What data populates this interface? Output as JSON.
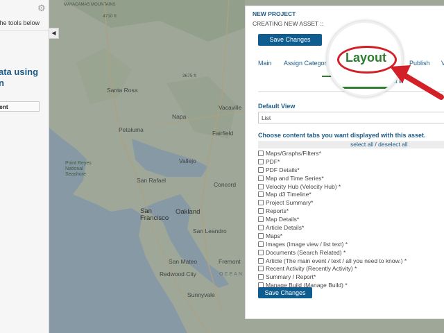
{
  "sidebar": {
    "hint_text": "the tools below",
    "heading_line1": "ata using",
    "heading_line2": "n",
    "button_label": "ent"
  },
  "map": {
    "labels": {
      "mountain": "MAYACAMAS MOUNTAINS",
      "elev1": "4710 ft",
      "elev2": "3675 ft",
      "santa_rosa": "Santa Rosa",
      "napa": "Napa",
      "petaluma": "Petaluma",
      "fairfield": "Fairfield",
      "vacaville": "Vacaville",
      "vallejo": "Vallejo",
      "point_reyes": "Point Reyes National Seashore",
      "san_rafael": "San Rafael",
      "concord": "Concord",
      "san_francisco": "San Francisco",
      "oakland": "Oakland",
      "san_leandro": "San Leandro",
      "san_mateo": "San Mateo",
      "redwood_city": "Redwood City",
      "fremont": "Fremont",
      "sunnyvale": "Sunnyvale",
      "ocean": "OCEAN"
    }
  },
  "dialog": {
    "title": "NEW PROJECT",
    "subtitle": "CREATING NEW ASSET ::",
    "save_label": "Save Changes",
    "tabs": [
      "Main",
      "Assign Categor",
      "Publish",
      "V"
    ],
    "edit_link": "ct in",
    "default_view_label": "Default View",
    "default_view_value": "List",
    "content_tabs_label": "Choose content tabs you want displayed with this asset.",
    "select_all": "select all / deselect all",
    "options": [
      "Maps/Graphs/Filters*",
      "PDF*",
      "PDF Details*",
      "Map and Time Series*",
      "Velocity Hub (Velocity Hub) *",
      "Map d3 Timeline*",
      "Project Summary*",
      "Reports*",
      "Map Details*",
      "Article Details*",
      "Maps*",
      "Images (Image view / list text) *",
      "Documents (Search Related) *",
      "Article (The main event / text / all you need to know.) *",
      "Recent Activity (Recently Activity) *",
      "Summary / Report*",
      "Manage Build (Manage Build) *"
    ]
  },
  "callout": {
    "text": "Layout",
    "accent_color": "#d21f28",
    "text_color": "#2f7e2f"
  }
}
